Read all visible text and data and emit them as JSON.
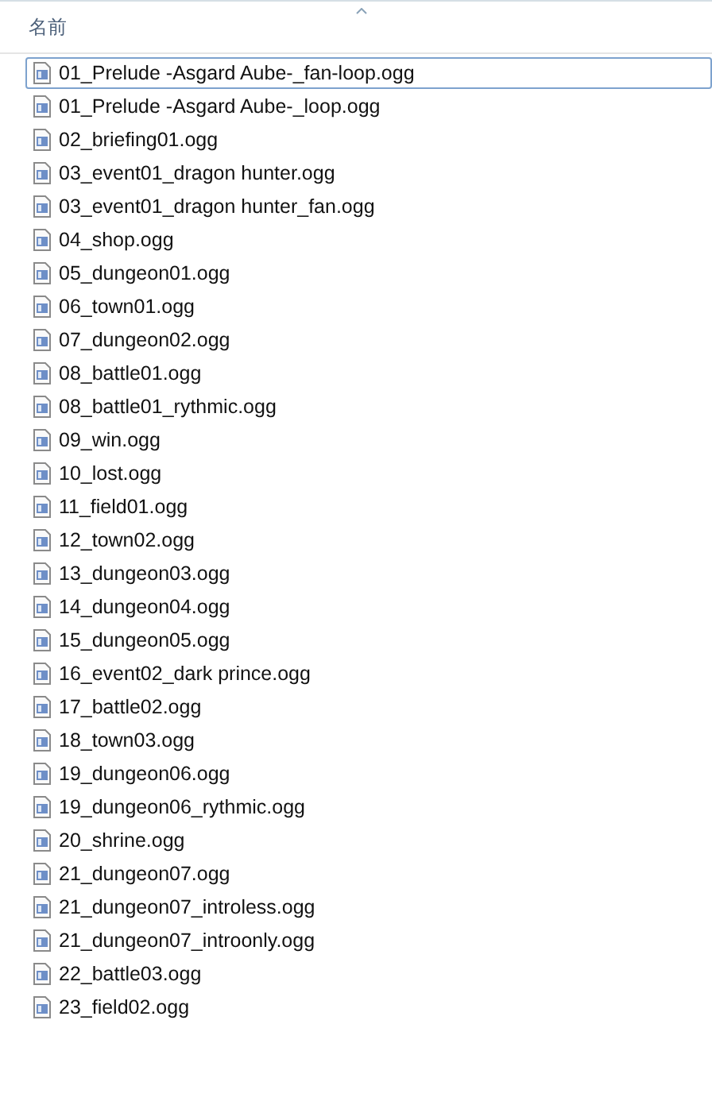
{
  "header": {
    "column": "名前"
  },
  "files": [
    {
      "name": "01_Prelude -Asgard Aube-_fan-loop.ogg",
      "focused": true
    },
    {
      "name": "01_Prelude -Asgard Aube-_loop.ogg",
      "focused": false
    },
    {
      "name": "02_briefing01.ogg",
      "focused": false
    },
    {
      "name": "03_event01_dragon hunter.ogg",
      "focused": false
    },
    {
      "name": "03_event01_dragon hunter_fan.ogg",
      "focused": false
    },
    {
      "name": "04_shop.ogg",
      "focused": false
    },
    {
      "name": "05_dungeon01.ogg",
      "focused": false
    },
    {
      "name": "06_town01.ogg",
      "focused": false
    },
    {
      "name": "07_dungeon02.ogg",
      "focused": false
    },
    {
      "name": "08_battle01.ogg",
      "focused": false
    },
    {
      "name": "08_battle01_rythmic.ogg",
      "focused": false
    },
    {
      "name": "09_win.ogg",
      "focused": false
    },
    {
      "name": "10_lost.ogg",
      "focused": false
    },
    {
      "name": "11_field01.ogg",
      "focused": false
    },
    {
      "name": "12_town02.ogg",
      "focused": false
    },
    {
      "name": "13_dungeon03.ogg",
      "focused": false
    },
    {
      "name": "14_dungeon04.ogg",
      "focused": false
    },
    {
      "name": "15_dungeon05.ogg",
      "focused": false
    },
    {
      "name": "16_event02_dark prince.ogg",
      "focused": false
    },
    {
      "name": "17_battle02.ogg",
      "focused": false
    },
    {
      "name": "18_town03.ogg",
      "focused": false
    },
    {
      "name": "19_dungeon06.ogg",
      "focused": false
    },
    {
      "name": "19_dungeon06_rythmic.ogg",
      "focused": false
    },
    {
      "name": "20_shrine.ogg",
      "focused": false
    },
    {
      "name": "21_dungeon07.ogg",
      "focused": false
    },
    {
      "name": "21_dungeon07_introless.ogg",
      "focused": false
    },
    {
      "name": "21_dungeon07_introonly.ogg",
      "focused": false
    },
    {
      "name": "22_battle03.ogg",
      "focused": false
    },
    {
      "name": "23_field02.ogg",
      "focused": false
    }
  ]
}
